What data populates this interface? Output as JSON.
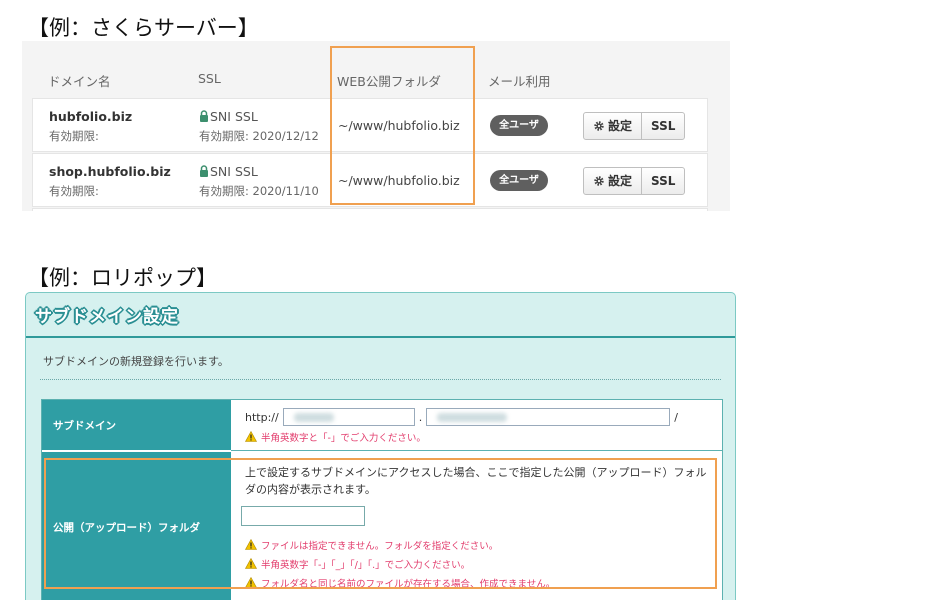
{
  "captions": {
    "sakura": "【例：さくらサーバー】",
    "lolipop": "【例：ロリポップ】"
  },
  "sakura": {
    "headers": {
      "domain": "ドメイン名",
      "ssl": "SSL",
      "web_folder": "WEB公開フォルダ",
      "mail": "メール利用"
    },
    "rows": [
      {
        "domain": "hubfolio.biz",
        "expiry_label": "有効期限:",
        "ssl": "SNI SSL",
        "ssl_expiry": "有効期限: 2020/12/12",
        "folder": "~/www/hubfolio.biz",
        "mail_badge": "全ユーザ",
        "settings_label": "設定",
        "ssl_button": "SSL"
      },
      {
        "domain": "shop.hubfolio.biz",
        "expiry_label": "有効期限:",
        "ssl": "SNI SSL",
        "ssl_expiry": "有効期限: 2020/11/10",
        "folder": "~/www/hubfolio.biz",
        "mail_badge": "全ユーザ",
        "settings_label": "設定",
        "ssl_button": "SSL"
      }
    ]
  },
  "lolipop": {
    "title": "サブドメイン設定",
    "description": "サブドメインの新規登録を行います。",
    "subdomain_label": "サブドメイン",
    "url_prefix": "http://",
    "url_dot": ".",
    "url_slash": "/",
    "subdomain_warning": "半角英数字と「-」でご入力ください。",
    "folder_label": "公開（アップロード）フォルダ",
    "folder_description": "上で設定するサブドメインにアクセスした場合、ここで指定した公開（アップロード）フォルダの内容が表示されます。",
    "folder_notes": [
      "ファイルは指定できません。フォルダを指定ください。",
      "半角英数字「-」「_」「/」「.」でご入力ください。",
      "フォルダ名と同じ名前のファイルが存在する場合、作成できません。"
    ]
  },
  "colors": {
    "highlight": "#f0a050",
    "lolipop_teal": "#2f9ea4",
    "warning_text": "#e23c6c"
  }
}
